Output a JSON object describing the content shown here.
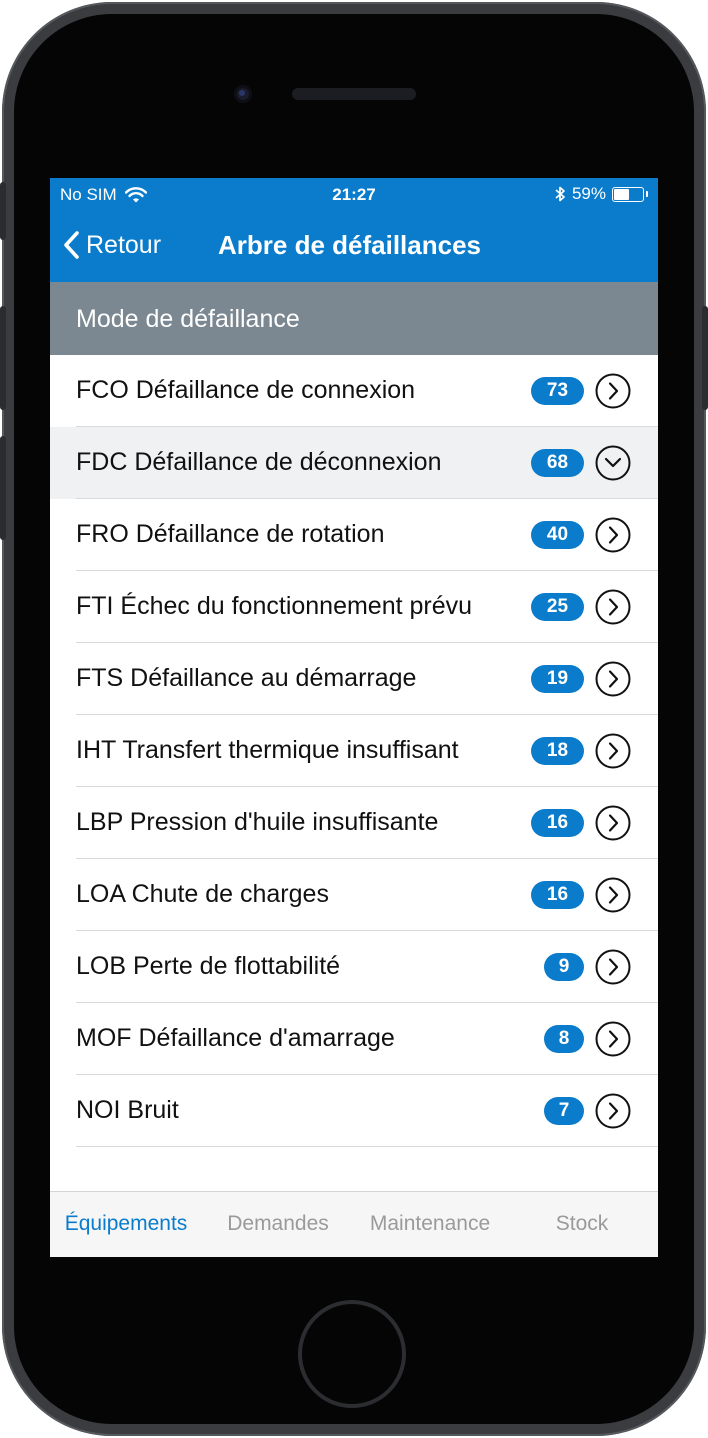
{
  "status_bar": {
    "carrier": "No SIM",
    "time": "21:27",
    "battery": "59%",
    "battery_level": 0.59
  },
  "nav": {
    "back_label": "Retour",
    "title": "Arbre de défaillances"
  },
  "section": {
    "title": "Mode de défaillance"
  },
  "rows": [
    {
      "label": "FCO Défaillance de connexion",
      "count": "73",
      "expanded": false
    },
    {
      "label": "FDC Défaillance de déconnexion",
      "count": "68",
      "expanded": true
    },
    {
      "label": "FRO Défaillance de rotation",
      "count": "40",
      "expanded": false
    },
    {
      "label": "FTI Échec du fonctionnement prévu",
      "count": "25",
      "expanded": false
    },
    {
      "label": "FTS Défaillance au démarrage",
      "count": "19",
      "expanded": false
    },
    {
      "label": "IHT Transfert thermique insuffisant",
      "count": "18",
      "expanded": false
    },
    {
      "label": "LBP Pression d'huile insuffisante",
      "count": "16",
      "expanded": false
    },
    {
      "label": "LOA Chute de charges",
      "count": "16",
      "expanded": false
    },
    {
      "label": "LOB Perte de flottabilité",
      "count": "9",
      "expanded": false
    },
    {
      "label": "MOF Défaillance d'amarrage",
      "count": "8",
      "expanded": false
    },
    {
      "label": "NOI Bruit",
      "count": "7",
      "expanded": false
    }
  ],
  "tabs": [
    {
      "label": "Équipements",
      "active": true
    },
    {
      "label": "Demandes",
      "active": false
    },
    {
      "label": "Maintenance",
      "active": false
    },
    {
      "label": "Stock",
      "active": false
    }
  ],
  "colors": {
    "accent": "#0a7ccb",
    "section_header": "#7b8891",
    "selected_row": "#eff1f3",
    "tab_inactive": "#9a9a9a"
  }
}
